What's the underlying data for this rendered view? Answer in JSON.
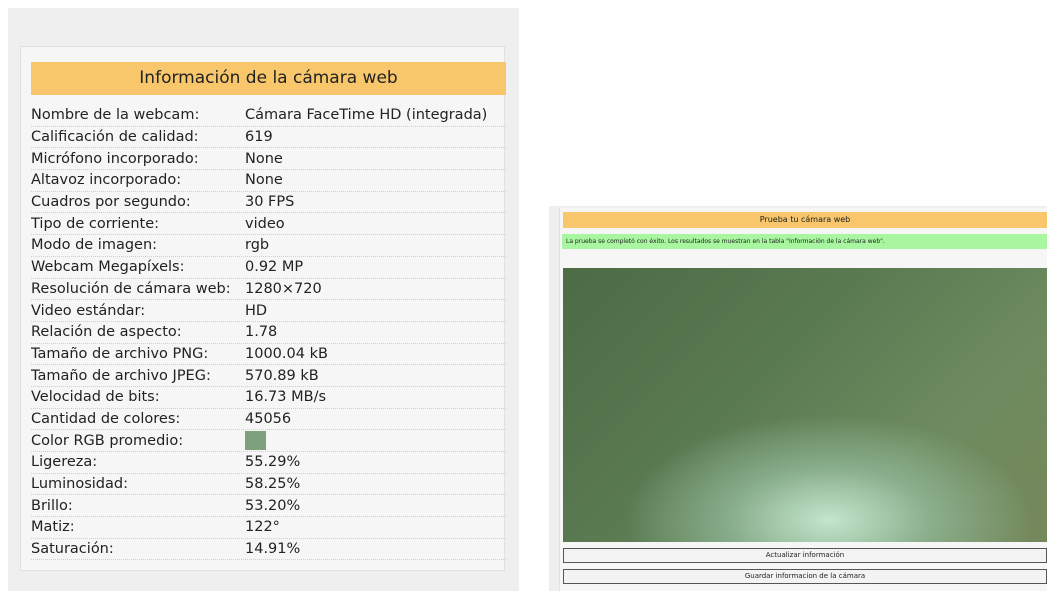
{
  "info": {
    "title": "Información de la cámara web",
    "rows": [
      {
        "label": "Nombre de la webcam:",
        "value": "Cámara FaceTime HD (integrada)"
      },
      {
        "label": "Calificación de calidad:",
        "value": "619"
      },
      {
        "label": "Micrófono incorporado:",
        "value": "None"
      },
      {
        "label": "Altavoz incorporado:",
        "value": "None"
      },
      {
        "label": "Cuadros por segundo:",
        "value": "30 FPS"
      },
      {
        "label": "Tipo de corriente:",
        "value": "video"
      },
      {
        "label": "Modo de imagen:",
        "value": "rgb"
      },
      {
        "label": "Webcam Megapíxels:",
        "value": "0.92 MP"
      },
      {
        "label": "Resolución de cámara web:",
        "value": "1280×720"
      },
      {
        "label": "Video estándar:",
        "value": "HD"
      },
      {
        "label": "Relación de aspecto:",
        "value": "1.78"
      },
      {
        "label": "Tamaño de archivo PNG:",
        "value": "1000.04 kB"
      },
      {
        "label": "Tamaño de archivo JPEG:",
        "value": "570.89 kB"
      },
      {
        "label": "Velocidad de bits:",
        "value": "16.73 MB/s"
      },
      {
        "label": "Cantidad de colores:",
        "value": "45056"
      },
      {
        "label": "Color RGB promedio:",
        "swatch": "#7fa07d"
      },
      {
        "label": "Ligereza:",
        "value": "55.29%"
      },
      {
        "label": "Luminosidad:",
        "value": "58.25%"
      },
      {
        "label": "Brillo:",
        "value": "53.20%"
      },
      {
        "label": "Matiz:",
        "value": "122°"
      },
      {
        "label": "Saturación:",
        "value": "14.91%"
      }
    ]
  },
  "test": {
    "title": "Prueba tu cámara web",
    "success_message": "La prueba se completó con éxito. Los resultados se muestran en la tabla \"Información de la cámara web\".",
    "refresh_button": "Actualizar información",
    "save_button": "Guardar informacion de la cámara"
  },
  "colors": {
    "header_bg": "#f8c76b",
    "success_bg": "#a8f7a0"
  }
}
